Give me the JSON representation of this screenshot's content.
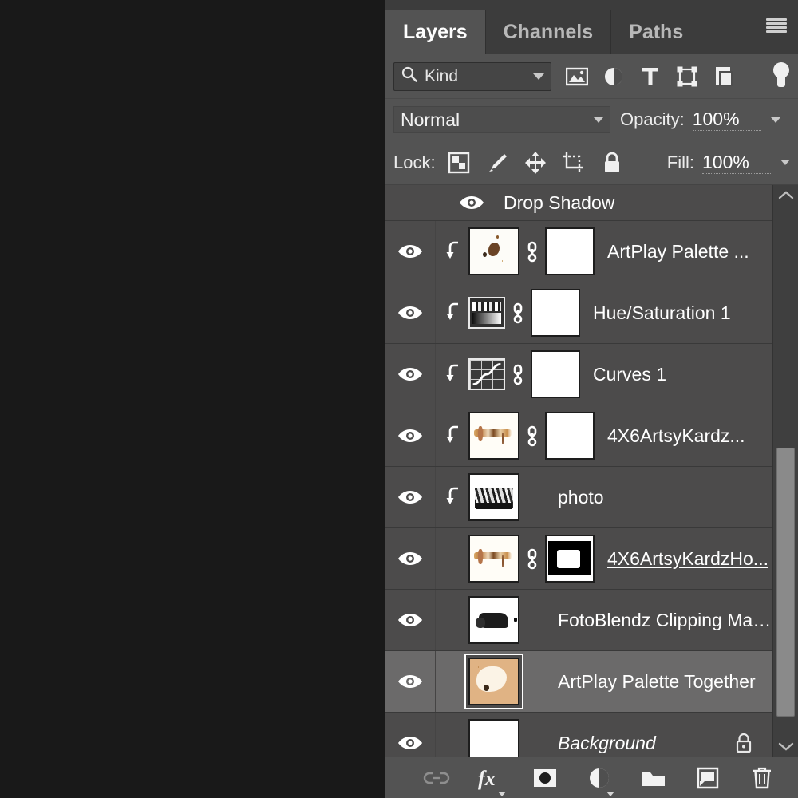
{
  "panel": {
    "tabs": [
      {
        "label": "Layers",
        "active": true
      },
      {
        "label": "Channels",
        "active": false
      },
      {
        "label": "Paths",
        "active": false
      }
    ],
    "menu_icon": "hamburger-menu-icon"
  },
  "filter": {
    "kind_label": "Kind",
    "search_icon": "search-icon",
    "icons": [
      "image-filter-icon",
      "adjustment-filter-icon",
      "type-filter-icon",
      "shape-filter-icon",
      "smartobject-filter-icon"
    ],
    "toggle": "filter-enable-toggle"
  },
  "blend": {
    "mode": "Normal",
    "opacity_label": "Opacity:",
    "opacity_value": "100%"
  },
  "lock": {
    "label": "Lock:",
    "icons": [
      "lock-transparency-icon",
      "lock-image-icon",
      "lock-position-icon",
      "lock-artboard-icon",
      "lock-all-icon"
    ],
    "fill_label": "Fill:",
    "fill_value": "100%"
  },
  "effect_row": {
    "name": "Drop Shadow",
    "visible": true
  },
  "layers": [
    {
      "name": "ArtPlay Palette ...",
      "visible": true,
      "clipped": true,
      "thumb": "art-splat",
      "linked": true,
      "mask": "art-white",
      "selected": false,
      "locked": false,
      "italic": false,
      "underline": false
    },
    {
      "name": "Hue/Saturation 1",
      "visible": true,
      "clipped": true,
      "thumb": "icon-hue",
      "linked": true,
      "mask": "art-white",
      "selected": false,
      "locked": false,
      "italic": false,
      "underline": false
    },
    {
      "name": "Curves 1",
      "visible": true,
      "clipped": true,
      "thumb": "icon-curves",
      "linked": true,
      "mask": "art-white",
      "selected": false,
      "locked": false,
      "italic": false,
      "underline": false
    },
    {
      "name": "4X6ArtsyKardz...",
      "visible": true,
      "clipped": true,
      "thumb": "art-strip",
      "linked": true,
      "mask": "art-white",
      "selected": false,
      "locked": false,
      "italic": false,
      "underline": false
    },
    {
      "name": "photo",
      "visible": true,
      "clipped": true,
      "thumb": "art-photo",
      "linked": false,
      "mask": null,
      "selected": false,
      "locked": false,
      "italic": false,
      "underline": false
    },
    {
      "name": "4X6ArtsyKardzHo...",
      "visible": true,
      "clipped": false,
      "thumb": "art-strip",
      "linked": true,
      "mask": "art-mask-shape",
      "selected": false,
      "locked": false,
      "italic": false,
      "underline": true
    },
    {
      "name": "FotoBlendz Clipping Mask ...",
      "visible": true,
      "clipped": false,
      "thumb": "art-blendz",
      "linked": false,
      "mask": null,
      "selected": false,
      "locked": false,
      "italic": false,
      "underline": false
    },
    {
      "name": "ArtPlay Palette Together",
      "visible": true,
      "clipped": false,
      "thumb": "art-together",
      "linked": false,
      "mask": null,
      "selected": true,
      "locked": false,
      "italic": false,
      "underline": false
    },
    {
      "name": "Background",
      "visible": true,
      "clipped": false,
      "thumb": "art-white",
      "linked": false,
      "mask": null,
      "selected": false,
      "locked": true,
      "italic": true,
      "underline": false
    }
  ],
  "bottom_toolbar": [
    {
      "icon": "link-layers-icon",
      "dim": true,
      "caret": false
    },
    {
      "icon": "layer-style-fx-icon",
      "dim": false,
      "caret": true
    },
    {
      "icon": "add-layer-mask-icon",
      "dim": false,
      "caret": false
    },
    {
      "icon": "new-adjustment-layer-icon",
      "dim": false,
      "caret": true
    },
    {
      "icon": "new-group-folder-icon",
      "dim": false,
      "caret": false
    },
    {
      "icon": "new-layer-icon",
      "dim": false,
      "caret": false
    },
    {
      "icon": "delete-layer-trash-icon",
      "dim": false,
      "caret": false
    }
  ],
  "scrollbar": {
    "up_arrow": "scroll-up-icon",
    "down_arrow": "scroll-down-icon",
    "thumb_top_pct": 46,
    "thumb_height_pct": 47
  },
  "colors": {
    "panel_bg": "#535353",
    "row_bg": "#4c4b4b",
    "row_selected": "#6b6a6a",
    "tab_bg": "#3c3c3c",
    "canvas_bg": "#191919",
    "text": "#ffffff"
  }
}
